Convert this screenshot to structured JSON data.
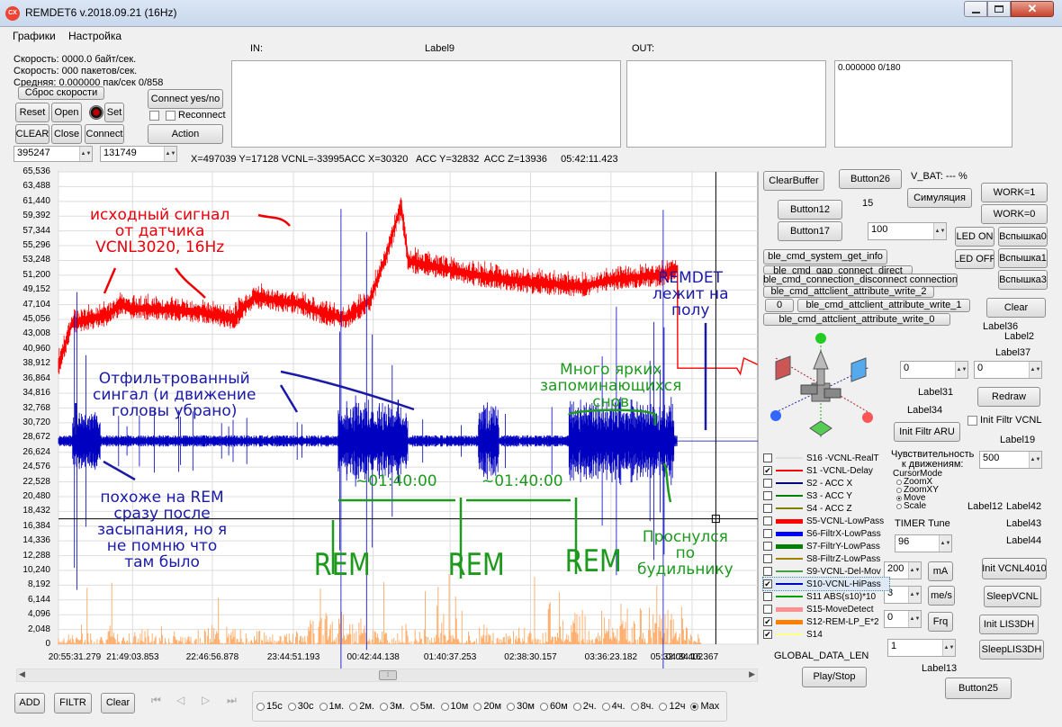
{
  "window": {
    "title": "REMDET6 v.2018.09.21 (16Hz)",
    "icon": "app-icon",
    "controls": [
      "minimize-icon",
      "maximize-icon",
      "close-icon"
    ]
  },
  "menu": [
    "Графики",
    "Настройка"
  ],
  "stats": {
    "speed_bytes": "Скорость: 0000.0 байт/сек.",
    "speed_packets": "Скорость: 000 пакетов/сек.",
    "avg": "Средняя: 0.000000 пак/сек 0/858"
  },
  "buttons": {
    "reset_speed": "Сброс скорости",
    "connect_yes_no": "Connect yes/no",
    "reset": "Reset",
    "open": "Open",
    "set": "Set",
    "reconnect": "Reconnect",
    "clear": "CLEAR",
    "close": "Close",
    "connect": "Connect",
    "action": "Action"
  },
  "fields": {
    "val1": "395247",
    "val2": "131749"
  },
  "labels": {
    "in": "IN:",
    "label9": "Label9",
    "out": "OUT:",
    "out2_text": "0.000000 0/180"
  },
  "status_line": "X=497039 Y=17128 VCNL=-33995ACC X=30320   ACC Y=32832  ACC Z=13936     05:42:11.423",
  "right": {
    "clear_buffer": "ClearBuffer",
    "button26": "Button26",
    "vbat": "V_BAT:  ---  %",
    "counter": "15",
    "simulation": "Симуляция",
    "work1": "WORK=1",
    "work0": "WORK=0",
    "button12": "Button12",
    "button17": "Button17",
    "spin100": "100",
    "led_on": "LED ON",
    "led_off": "LED OFF",
    "flash0": "Вспышка0",
    "flash1": "Вспышка1",
    "flash3": "Вспышка3",
    "ble1": "ble_cmd_system_get_info",
    "ble2": "ble_cmd_gap_connect_direct",
    "ble3": "ble_cmd_connection_disconnect connection",
    "ble4": "ble_cmd_attclient_attribute_write_2",
    "ble_zero": "0",
    "ble5": "ble_cmd_attclient_attribute_write_1",
    "ble6": "ble_cmd_attclient_attribute_write_0",
    "clear": "Clear",
    "label36": "Label36",
    "label2": "Label2",
    "label37": "Label37",
    "spin_a": "0",
    "spin_b": "0",
    "label31": "Label31",
    "redraw": "Redraw",
    "label34": "Label34",
    "init_filtr_aru": "Init Filtr ARU",
    "init_filtr_vcnl": "Init Filtr VCNL",
    "label19": "Label19",
    "sensitivity": "Чувствительность\nк движениям:",
    "sens_value": "500",
    "cursor_mode": "CursorMode",
    "cursor_opts": [
      "ZoomX",
      "ZoomXY",
      "Move",
      "Scale"
    ],
    "timer_tune": "TIMER Tune",
    "timer_value": "96",
    "label12": "Label12",
    "label42": "Label42",
    "label43": "Label43",
    "label44": "Label44",
    "ma_value": "200",
    "ma": "mA",
    "mes_value": "3",
    "mes": "me/s",
    "frq_value": "0",
    "frq": "Frq",
    "init_vcnl": "Init VCNL4010",
    "sleep_vcnl": "SleepVCNL",
    "init_lis": "Init LIS3DH",
    "sleep_lis": "SleepLIS3DH",
    "global": "GLOBAL_DATA_LEN",
    "spin_1": "1",
    "play_stop": "Play/Stop",
    "label13": "Label13",
    "button25": "Button25"
  },
  "legend": [
    {
      "checked": false,
      "color": "#e0e0e0",
      "label": "S16 -VCNL-RealT"
    },
    {
      "checked": true,
      "color": "#ff0000",
      "label": "S1 -VCNL-Delay"
    },
    {
      "checked": false,
      "color": "#000080",
      "label": "S2 - ACC X"
    },
    {
      "checked": false,
      "color": "#008000",
      "label": "S3 - ACC Y"
    },
    {
      "checked": false,
      "color": "#808000",
      "label": "S4 - ACC Z"
    },
    {
      "checked": false,
      "color": "#ff0000",
      "label": "S5-VCNL-LowPass"
    },
    {
      "checked": false,
      "color": "#0000ff",
      "label": "S6-FiltrX-LowPass"
    },
    {
      "checked": false,
      "color": "#008000",
      "label": "S7-FiltrY-LowPass"
    },
    {
      "checked": false,
      "color": "#a08000",
      "label": "S8-FiltrZ-LowPass"
    },
    {
      "checked": false,
      "color": "#40a040",
      "label": "S9-VCNL-Del-Mov"
    },
    {
      "checked": true,
      "color": "#0000c0",
      "label": "S10-VCNL-HiPass"
    },
    {
      "checked": false,
      "color": "#00a000",
      "label": "S11 ABS(s10)*10"
    },
    {
      "checked": false,
      "color": "#ff9090",
      "label": "S15-MoveDetect"
    },
    {
      "checked": true,
      "color": "#ff8000",
      "label": "S12-REM-LP_E*2"
    },
    {
      "checked": true,
      "color": "#ffff80",
      "label": "S14"
    }
  ],
  "bottom": {
    "add": "ADD",
    "filtr": "FILTR",
    "clear": "Clear",
    "nav_icons": [
      "first-icon",
      "prev-icon",
      "next-icon",
      "last-icon"
    ],
    "time_options": [
      "15с",
      "30с",
      "1м.",
      "2м.",
      "3м.",
      "5м.",
      "10м",
      "20м",
      "30м",
      "60м",
      "2ч.",
      "4ч.",
      "8ч.",
      "12ч",
      "Max"
    ],
    "time_selected": "Max"
  },
  "chart_data": {
    "type": "line",
    "y_ticks": [
      "65,536",
      "63,488",
      "61,440",
      "59,392",
      "57,344",
      "55,296",
      "53,248",
      "51,200",
      "49,152",
      "47,104",
      "45,056",
      "43,008",
      "40,960",
      "38,912",
      "36,864",
      "34,816",
      "32,768",
      "30,720",
      "28,672",
      "26,624",
      "24,576",
      "22,528",
      "20,480",
      "18,432",
      "16,384",
      "14,336",
      "12,288",
      "10,240",
      "8,192",
      "6,144",
      "4,096",
      "2,048",
      "0"
    ],
    "x_ticks": [
      "20:55:31.279",
      "21:49:03.853",
      "22:46:56.878",
      "23:44:51.193",
      "00:42:44.138",
      "01:40:37.253",
      "02:38:30.157",
      "03:36:23.182",
      "04:34:16.367",
      "05:32:09.402"
    ],
    "ylim": [
      0,
      65536
    ],
    "series": [
      {
        "name": "S1 -VCNL-Delay",
        "color": "#ff0000",
        "points": [
          [
            0,
            39000
          ],
          [
            0.02,
            45000
          ],
          [
            0.07,
            46000
          ],
          [
            0.09,
            47500
          ],
          [
            0.1,
            47000
          ],
          [
            0.2,
            46500
          ],
          [
            0.25,
            45500
          ],
          [
            0.28,
            48500
          ],
          [
            0.35,
            47500
          ],
          [
            0.37,
            46500
          ],
          [
            0.41,
            45500
          ],
          [
            0.445,
            48000
          ],
          [
            0.47,
            54500
          ],
          [
            0.48,
            58000
          ],
          [
            0.49,
            61000
          ],
          [
            0.5,
            53500
          ],
          [
            0.55,
            52500
          ],
          [
            0.6,
            51500
          ],
          [
            0.68,
            50500
          ],
          [
            0.75,
            50000
          ],
          [
            0.8,
            51000
          ],
          [
            0.86,
            51500
          ],
          [
            0.885,
            52500
          ],
          [
            0.8855,
            38300
          ],
          [
            0.97,
            38300
          ],
          [
            0.975,
            37500
          ],
          [
            0.98,
            39700
          ],
          [
            1.0,
            38800
          ]
        ]
      },
      {
        "name": "S10-VCNL-HiPass",
        "color": "#0000c0",
        "baseline": 28200
      }
    ]
  },
  "annotations": {
    "src": "исходный сигнал\nот датчика\nVCNL3020, 16Hz",
    "floor": "REMDET\nлежит на\nполу",
    "filtered": "Отфильтрованный\nсингал (и движение\nголовы убрано)",
    "dreams": "Много ярких\nзапоминающихся\nснов",
    "rem_like": "похоже на REM\nсразу после\nзасыпания, но я\nне помню что\nтам было",
    "interval1": "~01:40:00",
    "interval2": "~01:40:00",
    "rem1": "REM",
    "rem2": "REM",
    "rem3": "REM",
    "alarm": "Проснулся\nпо\nбудильнику"
  }
}
